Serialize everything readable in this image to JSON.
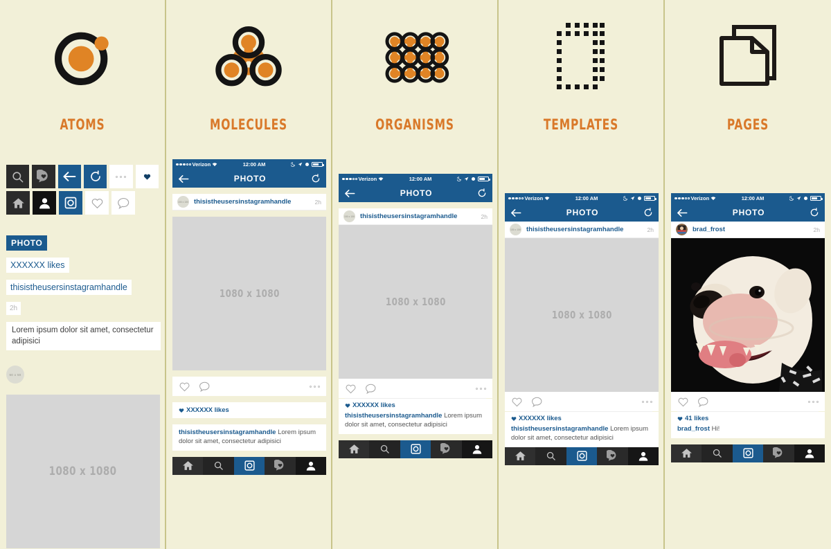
{
  "palette": {
    "background": "#f2f0d8",
    "divider": "#c8c48a",
    "accent_orange": "#d9792a",
    "brand_blue": "#1b5a8e",
    "dark": "#2b2b2b",
    "placeholder_gray": "#d6d6d6"
  },
  "columns": [
    {
      "id": "atoms",
      "title": "ATOMS",
      "glyph": "atom-icon",
      "icons": [
        {
          "name": "search-icon",
          "style": "dark"
        },
        {
          "name": "activity-heart-icon",
          "style": "dark"
        },
        {
          "name": "back-arrow-icon",
          "style": "blue"
        },
        {
          "name": "refresh-icon",
          "style": "blue"
        },
        {
          "name": "more-options-icon",
          "style": "white"
        },
        {
          "name": "heart-filled-icon",
          "style": "white"
        },
        {
          "name": "home-icon",
          "style": "dark"
        },
        {
          "name": "profile-icon",
          "style": "black"
        },
        {
          "name": "camera-icon",
          "style": "blue"
        },
        {
          "name": "heart-outline-icon",
          "style": "white"
        },
        {
          "name": "comment-icon",
          "style": "white"
        }
      ],
      "swatches": {
        "photo_chip": "PHOTO",
        "likes": "XXXXXX likes",
        "handle": "thisistheusersinstagramhandle",
        "time": "2h",
        "caption": "Lorem ipsum dolor sit amet, consectetur adipisici"
      },
      "avatar_label": "50 x 50",
      "photo_placeholder": "1080 x 1080"
    },
    {
      "id": "molecules",
      "title": "MOLECULES",
      "glyph": "molecule-icon"
    },
    {
      "id": "organisms",
      "title": "ORGANISMS",
      "glyph": "organism-grid-icon"
    },
    {
      "id": "templates",
      "title": "TEMPLATES",
      "glyph": "dashed-rect-icon"
    },
    {
      "id": "pages",
      "title": "PAGES",
      "glyph": "pages-stack-icon"
    }
  ],
  "phone": {
    "status": {
      "carrier": "Verizon",
      "time": "12:00 AM",
      "signal_dots": "•••oo",
      "wifi": "wifi-icon",
      "moon": "do-not-disturb-icon",
      "location": "location-arrow-icon",
      "alarm": "alarm-icon",
      "battery": "battery-icon"
    },
    "nav": {
      "back": "back-arrow-icon",
      "title": "PHOTO",
      "refresh": "refresh-icon"
    },
    "post": {
      "avatar_label": "150 x 150",
      "handle": "thisistheusersinstagramhandle",
      "time": "2h",
      "media_placeholder": "1080 x 1080",
      "likes": "XXXXXX likes",
      "caption_handle": "thisistheusersinstagramhandle",
      "caption_text": "Lorem ipsum dolor sit amet, consectetur adipisici"
    },
    "post_real": {
      "handle": "brad_frost",
      "time": "2h",
      "likes": "41 likes",
      "caption_handle": "brad_frost",
      "caption_text": "Hi!",
      "media": "bulldog-photo"
    },
    "actions": {
      "like": "heart-outline-icon",
      "comment": "comment-icon",
      "more": "more-options-icon"
    },
    "tabs": [
      {
        "name": "tab-home",
        "icon": "home-icon"
      },
      {
        "name": "tab-search",
        "icon": "search-icon"
      },
      {
        "name": "tab-camera",
        "icon": "camera-icon",
        "active": true
      },
      {
        "name": "tab-activity",
        "icon": "activity-heart-icon"
      },
      {
        "name": "tab-profile",
        "icon": "profile-icon"
      }
    ]
  }
}
